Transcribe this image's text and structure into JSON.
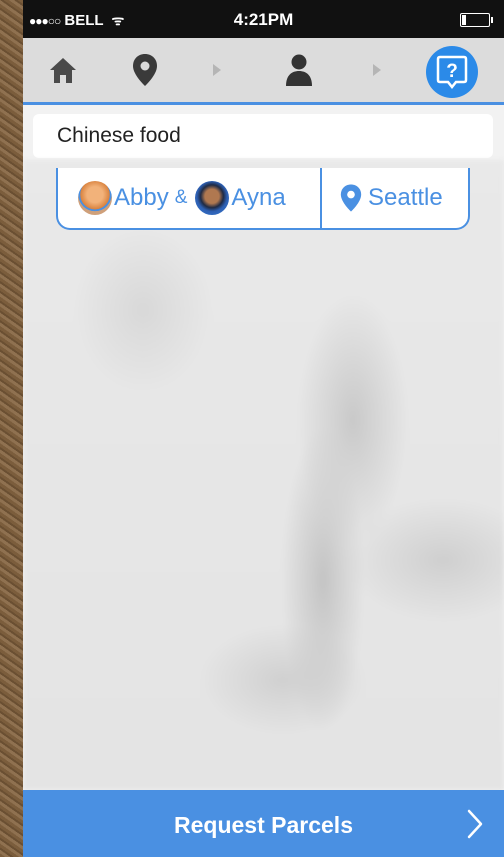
{
  "status_bar": {
    "signal_dots": "●●●○○",
    "carrier": "BELL",
    "wifi_glyph": "ᯤ",
    "time": "4:21PM",
    "battery_level": 0.15
  },
  "nav": {
    "icons": [
      "home-icon",
      "location-pin-icon",
      "arrow-right-icon",
      "person-icon",
      "arrow-right-icon",
      "help-icon"
    ],
    "help_glyph": "?",
    "underline_color": "#4a90e2"
  },
  "search": {
    "value": "Chinese food"
  },
  "selection": {
    "person1": "Abby",
    "amp": "&",
    "person2": "Ayna",
    "location": "Seattle"
  },
  "request": {
    "label": "Request Parcels",
    "chevron": "›"
  },
  "colors": {
    "accent": "#4a90e2",
    "help_button": "#2b8ae8"
  }
}
